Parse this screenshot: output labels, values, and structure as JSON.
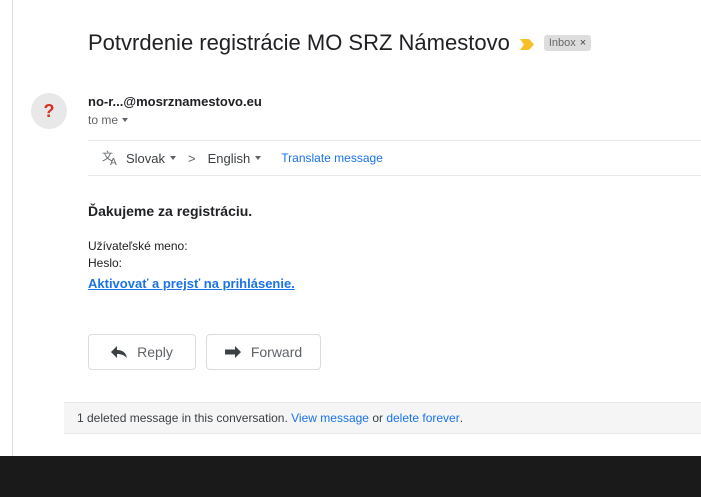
{
  "email": {
    "subject": "Potvrdenie registrácie MO SRZ Námestovo",
    "label": "Inbox",
    "label_close": "×",
    "avatar_glyph": "?",
    "sender": "no-r...@mosrznamestovo.eu",
    "recipient": "to me"
  },
  "translate": {
    "source_lang": "Slovak",
    "arrow": ">",
    "target_lang": "English",
    "link": "Translate message"
  },
  "body": {
    "heading": "Ďakujeme za registráciu.",
    "username_label": "Užívateľské meno:",
    "password_label": "Heslo:",
    "activate_link": "Aktivovať a prejsť na prihlásenie."
  },
  "actions": {
    "reply": "Reply",
    "forward": "Forward"
  },
  "deleted": {
    "text": "1 deleted message in this conversation.",
    "view_link": "View message",
    "or": "or",
    "delete_link": "delete forever",
    "period": "."
  },
  "colors": {
    "link": "#1a73e8",
    "importance": "#f6c026",
    "avatar_question": "#d93025"
  }
}
